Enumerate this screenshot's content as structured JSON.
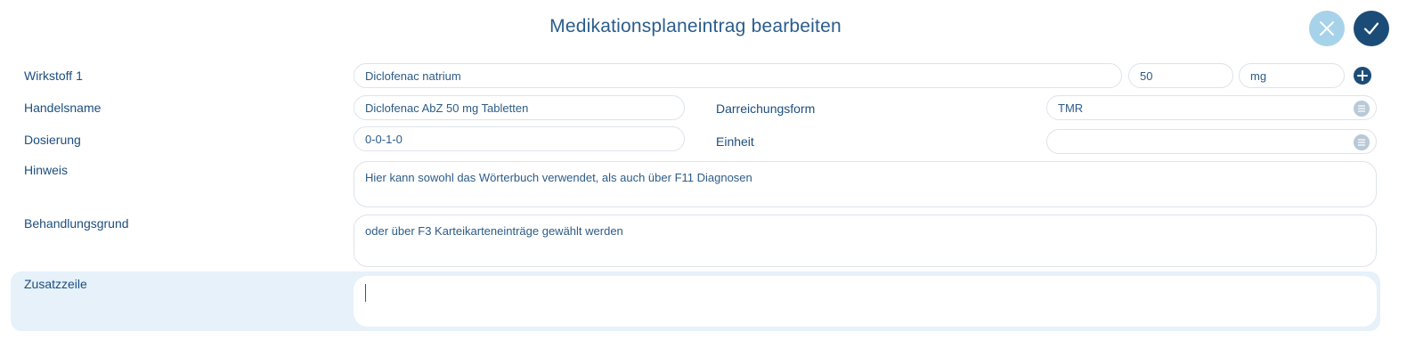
{
  "header": {
    "title": "Medikationsplaneintrag bearbeiten",
    "cancel_icon": "close-icon",
    "confirm_icon": "check-icon"
  },
  "form": {
    "wirkstoff": {
      "label": "Wirkstoff 1",
      "value": "Diclofenac natrium",
      "amount": "50",
      "unit": "mg"
    },
    "handelsname": {
      "label": "Handelsname",
      "value": "Diclofenac AbZ 50 mg Tabletten"
    },
    "darreichungsform": {
      "label": "Darreichungsform",
      "value": "TMR"
    },
    "dosierung": {
      "label": "Dosierung",
      "value": "0-0-1-0"
    },
    "einheit": {
      "label": "Einheit",
      "value": ""
    },
    "hinweis": {
      "label": "Hinweis",
      "value": "Hier kann sowohl das Wörterbuch verwendet, als auch über F11 Diagnosen"
    },
    "behandlungsgrund": {
      "label": "Behandlungsgrund",
      "value": "oder über F3 Karteikarteneinträge gewählt werden"
    },
    "zusatzzeile": {
      "label": "Zusatzzeile",
      "value": ""
    }
  },
  "colors": {
    "primary": "#1b4c78",
    "cancel": "#a7d3ea",
    "highlight": "#e6f1fa",
    "border": "#dde3ea"
  }
}
